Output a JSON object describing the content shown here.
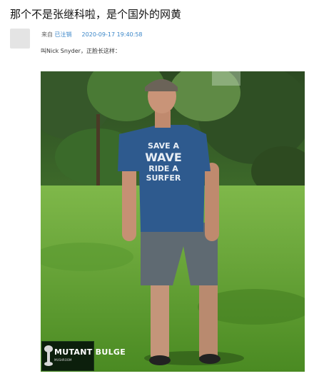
{
  "post": {
    "title": "那个不是张继科啦，是个国外的网黄",
    "source_prefix": "来自",
    "source_name": "已注销",
    "timestamp": "2020-09-17 19:40:58",
    "body": "叫Nick Snyder，正脸长这样："
  },
  "photo": {
    "shirt_text": [
      "SAVE A",
      "WAVE",
      "RIDE A",
      "SURFER"
    ],
    "watermark_logo": "MUTANT BULGE",
    "watermark_sub": "MUSHROOM"
  },
  "colors": {
    "link": "#3a86c8",
    "grass": "#4f8f2a",
    "shirt": "#2e5a8e"
  }
}
